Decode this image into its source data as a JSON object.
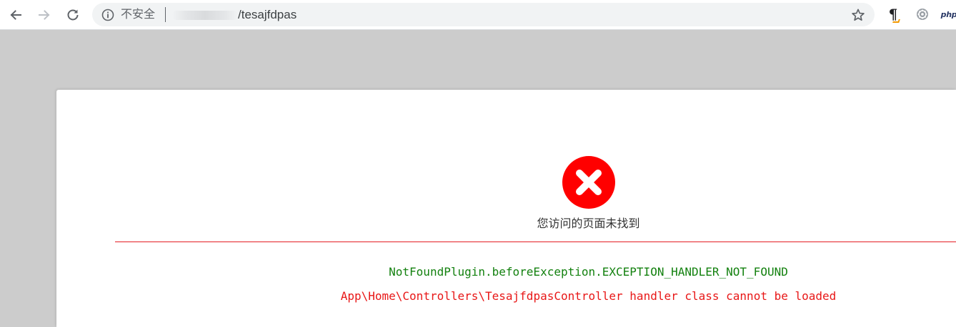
{
  "browser": {
    "security_label": "不安全",
    "url_path": "/tesajfdpas",
    "icons": {
      "back": "arrow-left-icon",
      "forward": "arrow-right-icon",
      "reload": "reload-icon",
      "info": "info-circle-icon",
      "bookmark": "star-icon",
      "extension_1": "pilcrow-icon",
      "extension_2": "gear-icon",
      "extension_3": "php-icon"
    },
    "extensions": {
      "php_label": "php"
    },
    "colors": {
      "toolbar_bg": "#ffffff",
      "omnibox_bg": "#f1f3f4",
      "page_bg": "#cccccc"
    }
  },
  "page": {
    "error_title": "您访问的页面未找到",
    "error_code": "NotFoundPlugin.beforeException.EXCEPTION_HANDLER_NOT_FOUND",
    "error_message": "App\\Home\\Controllers\\TesajfdpasController handler class cannot be loaded",
    "error_icon": "error-x-circle-icon",
    "colors": {
      "error_red": "#ff0000",
      "rule_red": "#e51c23",
      "code_green": "#13810f",
      "message_red": "#e81717"
    }
  }
}
